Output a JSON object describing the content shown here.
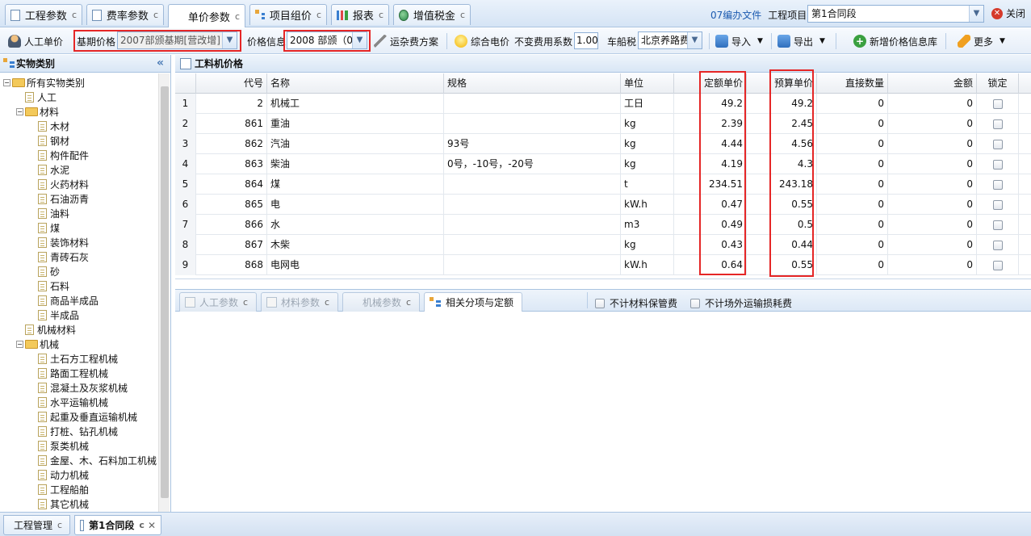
{
  "top_tabs": [
    {
      "label": "工程参数",
      "icon": "document-icon"
    },
    {
      "label": "费率参数",
      "icon": "document-icon"
    },
    {
      "label": "单价参数",
      "icon": "document-icon"
    },
    {
      "label": "项目组价",
      "icon": "tree-icon"
    },
    {
      "label": "报表",
      "icon": "chart-icon"
    },
    {
      "label": "增值税金",
      "icon": "globe-icon"
    }
  ],
  "tab_close_glyph": "c",
  "top_right": {
    "file_link": "07编办文件",
    "project_label": "工程项目:",
    "project_value": "第1合同段",
    "close_label": "关闭"
  },
  "toolbar": {
    "labor_price": "人工单价",
    "base_price_label": "基期价格",
    "base_price_value": "2007部颁基期[营改增]",
    "price_info_label": "价格信息",
    "price_info_value": "2008 部颁（0",
    "freight_plan": "运杂费方案",
    "electricity": "综合电价",
    "coef_label": "不变费用系数",
    "coef_value": "1.00",
    "vehicle_tax_label": "车船税",
    "vehicle_tax_value": "北京养路费",
    "import": "导入",
    "export": "导出",
    "add_price_db": "新增价格信息库",
    "more": "更多"
  },
  "left_panel": {
    "title": "实物类别",
    "tree": [
      {
        "label": "所有实物类别",
        "level": 0,
        "type": "folder",
        "expanded": true
      },
      {
        "label": "人工",
        "level": 1,
        "type": "leaf"
      },
      {
        "label": "材料",
        "level": 1,
        "type": "folder",
        "expanded": true
      },
      {
        "label": "木材",
        "level": 2,
        "type": "leaf"
      },
      {
        "label": "钢材",
        "level": 2,
        "type": "leaf"
      },
      {
        "label": "构件配件",
        "level": 2,
        "type": "leaf"
      },
      {
        "label": "水泥",
        "level": 2,
        "type": "leaf"
      },
      {
        "label": "火药材料",
        "level": 2,
        "type": "leaf"
      },
      {
        "label": "石油沥青",
        "level": 2,
        "type": "leaf"
      },
      {
        "label": "油料",
        "level": 2,
        "type": "leaf"
      },
      {
        "label": "煤",
        "level": 2,
        "type": "leaf"
      },
      {
        "label": "装饰材料",
        "level": 2,
        "type": "leaf"
      },
      {
        "label": "青砖石灰",
        "level": 2,
        "type": "leaf"
      },
      {
        "label": "砂",
        "level": 2,
        "type": "leaf"
      },
      {
        "label": "石料",
        "level": 2,
        "type": "leaf"
      },
      {
        "label": "商品半成品",
        "level": 2,
        "type": "leaf"
      },
      {
        "label": "半成品",
        "level": 2,
        "type": "leaf"
      },
      {
        "label": "机械材料",
        "level": 1,
        "type": "leaf"
      },
      {
        "label": "机械",
        "level": 1,
        "type": "folder",
        "expanded": true
      },
      {
        "label": "土石方工程机械",
        "level": 2,
        "type": "leaf"
      },
      {
        "label": "路面工程机械",
        "level": 2,
        "type": "leaf"
      },
      {
        "label": "混凝土及灰浆机械",
        "level": 2,
        "type": "leaf"
      },
      {
        "label": "水平运输机械",
        "level": 2,
        "type": "leaf"
      },
      {
        "label": "起重及垂直运输机械",
        "level": 2,
        "type": "leaf"
      },
      {
        "label": "打桩、钻孔机械",
        "level": 2,
        "type": "leaf"
      },
      {
        "label": "泵类机械",
        "level": 2,
        "type": "leaf"
      },
      {
        "label": "金屋、木、石料加工机械",
        "level": 2,
        "type": "leaf"
      },
      {
        "label": "动力机械",
        "level": 2,
        "type": "leaf"
      },
      {
        "label": "工程船舶",
        "level": 2,
        "type": "leaf"
      },
      {
        "label": "其它机械",
        "level": 2,
        "type": "leaf"
      }
    ]
  },
  "grid": {
    "title": "工料机价格",
    "columns": [
      "",
      "代号",
      "名称",
      "规格",
      "单位",
      "定额单价",
      "预算单价",
      "直接数量",
      "金额",
      "锁定"
    ],
    "rows": [
      [
        "1",
        "2",
        "机械工",
        "",
        "工日",
        "49.2",
        "49.2",
        "0",
        "0"
      ],
      [
        "2",
        "861",
        "重油",
        "",
        "kg",
        "2.39",
        "2.45",
        "0",
        "0"
      ],
      [
        "3",
        "862",
        "汽油",
        "93号",
        "kg",
        "4.44",
        "4.56",
        "0",
        "0"
      ],
      [
        "4",
        "863",
        "柴油",
        "0号，-10号，-20号",
        "kg",
        "4.19",
        "4.3",
        "0",
        "0"
      ],
      [
        "5",
        "864",
        "煤",
        "",
        "t",
        "234.51",
        "243.18",
        "0",
        "0"
      ],
      [
        "6",
        "865",
        "电",
        "",
        "kW.h",
        "0.47",
        "0.55",
        "0",
        "0"
      ],
      [
        "7",
        "866",
        "水",
        "",
        "m3",
        "0.49",
        "0.5",
        "0",
        "0"
      ],
      [
        "8",
        "867",
        "木柴",
        "",
        "kg",
        "0.43",
        "0.44",
        "0",
        "0"
      ],
      [
        "9",
        "868",
        "电网电",
        "",
        "kW.h",
        "0.64",
        "0.55",
        "0",
        "0"
      ]
    ]
  },
  "bottom_tabs": [
    {
      "label": "人工参数"
    },
    {
      "label": "材料参数"
    },
    {
      "label": "机械参数"
    },
    {
      "label": "相关分项与定额"
    }
  ],
  "bottom_checks": [
    "不计材料保管费",
    "不计场外运输损耗费"
  ],
  "footer_tabs": [
    {
      "label": "工程管理"
    },
    {
      "label": "第1合同段"
    }
  ],
  "highlight_color": "#e52626"
}
